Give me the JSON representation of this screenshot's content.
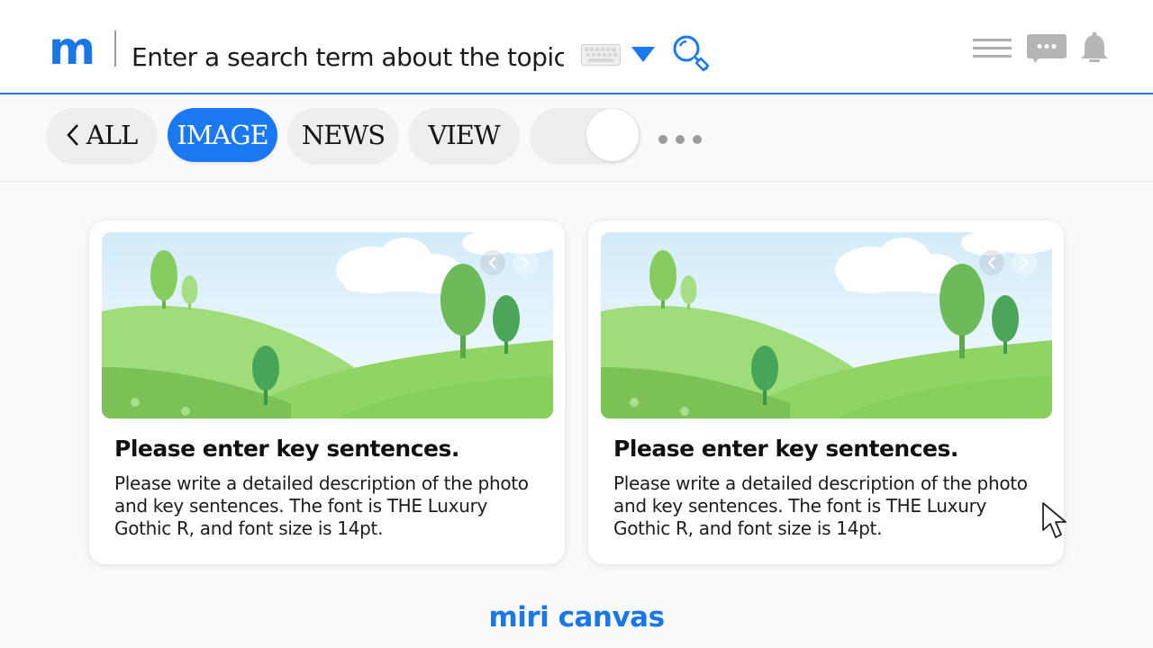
{
  "header": {
    "logo": "m",
    "search_placeholder": "Enter a search term about the topic.",
    "icons": [
      "keyboard-icon",
      "dropdown-triangle-icon",
      "search-icon",
      "hamburger-menu-icon",
      "chat-icon",
      "bell-icon"
    ]
  },
  "tabs": {
    "all_label": "ALL",
    "image_label": "IMAGE",
    "news_label": "NEWS",
    "view_label": "VIEW",
    "active": "IMAGE",
    "toggle_on": true
  },
  "cards": [
    {
      "title": "Please enter key sentences.",
      "description": "Please write a detailed description of the photo and key sentences. The font is THE Luxury Gothic R, and font size is 14pt."
    },
    {
      "title": "Please enter key sentences.",
      "description": "Please write a detailed description of the photo and key sentences. The font is THE Luxury Gothic R, and font size is 14pt."
    }
  ],
  "footer": {
    "brand": "miri canvas"
  },
  "colors": {
    "accent": "#1a78f0",
    "pill_bg": "#eeeeee",
    "text": "#141414"
  }
}
